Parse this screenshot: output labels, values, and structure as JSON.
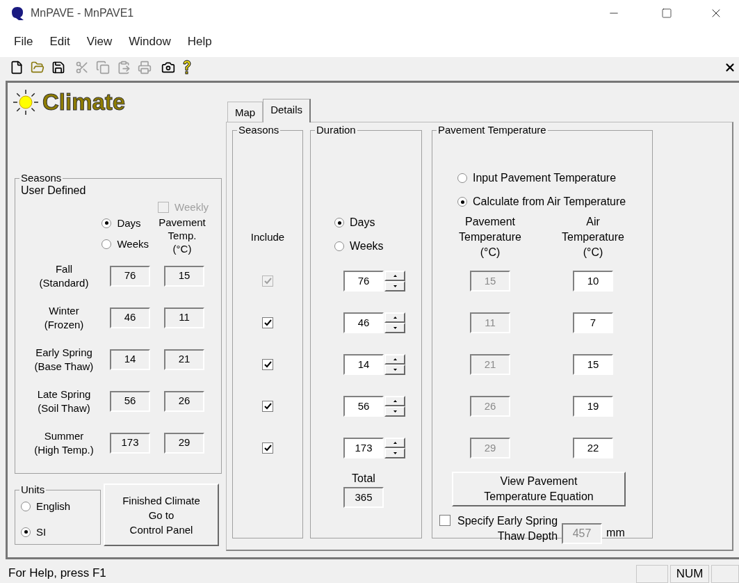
{
  "window": {
    "title": "MnPAVE - MnPAVE1"
  },
  "menu": [
    "File",
    "Edit",
    "View",
    "Window",
    "Help"
  ],
  "toolbar": [
    {
      "kind": "new",
      "disabled": false
    },
    {
      "kind": "open",
      "disabled": false
    },
    {
      "kind": "save",
      "disabled": false
    },
    {
      "kind": "cut",
      "disabled": true
    },
    {
      "kind": "copy",
      "disabled": true
    },
    {
      "kind": "paste",
      "disabled": true
    },
    {
      "kind": "pdf",
      "disabled": true
    },
    {
      "kind": "camera",
      "disabled": false
    },
    {
      "kind": "help",
      "disabled": false
    }
  ],
  "heading": "Climate",
  "seasons_group": {
    "title": "Seasons",
    "subtitle": "User Defined",
    "weekly": {
      "label": "Weekly",
      "checked": false,
      "disabled": true
    },
    "unit_options": [
      {
        "label": "Days",
        "selected": true
      },
      {
        "label": "Weeks",
        "selected": false
      }
    ],
    "temp_header": "Pavement\nTemp.\n(°C)",
    "rows": [
      {
        "name": "Fall\n(Standard)",
        "duration": "76",
        "temp": "15"
      },
      {
        "name": "Winter\n(Frozen)",
        "duration": "46",
        "temp": "11"
      },
      {
        "name": "Early Spring\n(Base Thaw)",
        "duration": "14",
        "temp": "21"
      },
      {
        "name": "Late Spring\n(Soil Thaw)",
        "duration": "56",
        "temp": "26"
      },
      {
        "name": "Summer\n(High Temp.)",
        "duration": "173",
        "temp": "29"
      }
    ]
  },
  "units": {
    "title": "Units",
    "options": [
      {
        "label": "English",
        "selected": false
      },
      {
        "label": "SI",
        "selected": true
      }
    ]
  },
  "finish_button": "Finished Climate\nGo to\nControl Panel",
  "tabs": [
    {
      "label": "Map",
      "selected": false
    },
    {
      "label": "Details",
      "selected": true
    }
  ],
  "details": {
    "seasons_title": "Seasons",
    "include_label": "Include",
    "duration_title": "Duration",
    "duration_options": [
      {
        "label": "Days",
        "selected": true
      },
      {
        "label": "Weeks",
        "selected": false
      }
    ],
    "pavement_title": "Pavement Temperature",
    "temp_options": [
      {
        "label": "Input Pavement Temperature",
        "selected": false
      },
      {
        "label": "Calculate from Air Temperature",
        "selected": true
      }
    ],
    "pavement_header": "Pavement\nTemperature\n(°C)",
    "air_header": "Air\nTemperature\n(°C)",
    "pavement_temps_disabled": true,
    "rows": [
      {
        "include": true,
        "include_disabled": true,
        "duration": "76",
        "pavement_temp": "15",
        "air_temp": "10"
      },
      {
        "include": true,
        "include_disabled": false,
        "duration": "46",
        "pavement_temp": "11",
        "air_temp": "7"
      },
      {
        "include": true,
        "include_disabled": false,
        "duration": "14",
        "pavement_temp": "21",
        "air_temp": "15"
      },
      {
        "include": true,
        "include_disabled": false,
        "duration": "56",
        "pavement_temp": "26",
        "air_temp": "19"
      },
      {
        "include": true,
        "include_disabled": false,
        "duration": "173",
        "pavement_temp": "29",
        "air_temp": "22"
      }
    ],
    "total_label": "Total",
    "total": "365",
    "equation_button": "View Pavement\nTemperature Equation",
    "thaw": {
      "label": "Specify Early Spring\nThaw Depth",
      "checked": false,
      "value": "457",
      "unit": "mm"
    }
  },
  "status_bar": {
    "text": "For Help, press F1",
    "indicator": "NUM"
  }
}
